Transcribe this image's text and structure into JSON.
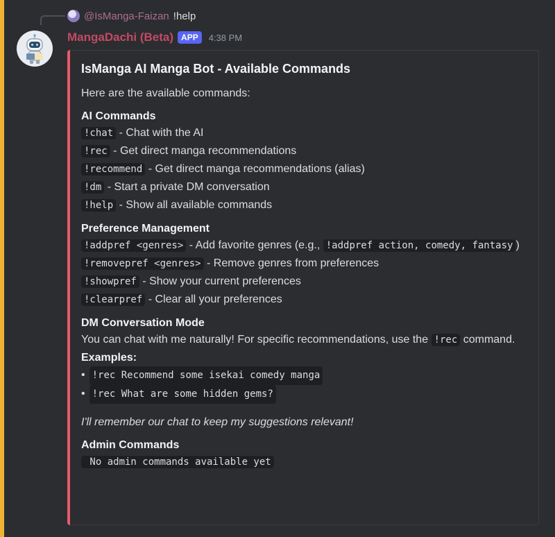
{
  "reply": {
    "author": "@IsManga-Faizan",
    "text": "!help"
  },
  "message": {
    "author": "MangaDachi (Beta)",
    "badge": "APP",
    "timestamp": "4:38 PM"
  },
  "embed": {
    "title": "IsManga AI Manga Bot - Available Commands",
    "description": "Here are the available commands:",
    "ai": {
      "name": "AI Commands",
      "items": [
        {
          "cmd": "!chat",
          "desc": " - Chat with the AI"
        },
        {
          "cmd": "!rec",
          "desc": " - Get direct manga recommendations"
        },
        {
          "cmd": "!recommend",
          "desc": " - Get direct manga recommendations (alias)"
        },
        {
          "cmd": "!dm",
          "desc": " - Start a private DM conversation"
        },
        {
          "cmd": "!help",
          "desc": " - Show all available commands"
        }
      ]
    },
    "pref": {
      "name": "Preference Management",
      "addpref_cmd": "!addpref <genres>",
      "addpref_desc": " - Add favorite genres (e.g., ",
      "addpref_example": "!addpref action, comedy, fantasy",
      "addpref_tail": ")",
      "items": [
        {
          "cmd": "!removepref <genres>",
          "desc": " - Remove genres from preferences"
        },
        {
          "cmd": "!showpref",
          "desc": " - Show your current preferences"
        },
        {
          "cmd": "!clearpref",
          "desc": " - Clear all your preferences"
        }
      ]
    },
    "dm": {
      "name": "DM Conversation Mode",
      "text": "You can chat with me naturally! For specific recommendations, use the ",
      "text_cmd": "!rec",
      "text_tail": " command.",
      "examples_label": "Examples:",
      "examples": [
        "!rec Recommend some isekai comedy manga",
        "!rec What are some hidden gems?"
      ],
      "note": "I'll remember our chat to keep my suggestions relevant!"
    },
    "admin": {
      "name": "Admin Commands",
      "text": " No admin commands available yet"
    }
  }
}
